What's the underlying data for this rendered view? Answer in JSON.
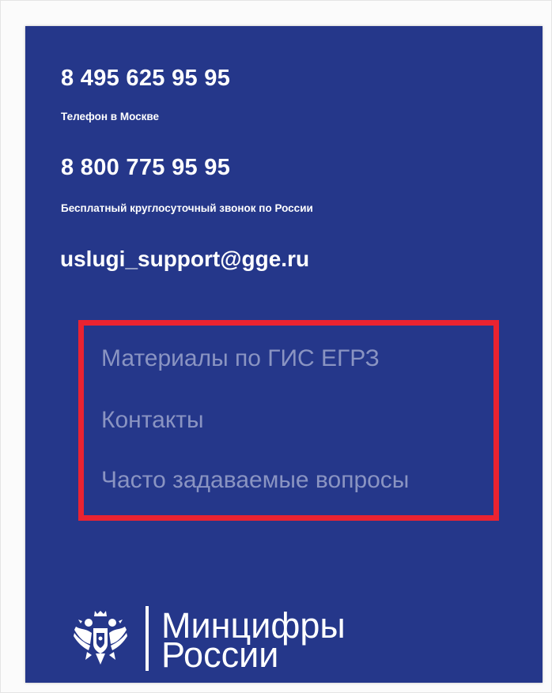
{
  "contacts": {
    "phone_moscow": "8 495 625 95 95",
    "phone_moscow_caption": "Телефон в Москве",
    "phone_free": "8 800 775 95 95",
    "phone_free_caption": "Бесплатный круглосуточный звонок по России",
    "email": "uslugi_support@gge.ru"
  },
  "nav": {
    "items": [
      {
        "label": "Материалы по ГИС ЕГРЗ"
      },
      {
        "label": "Контакты"
      },
      {
        "label": "Часто задаваемые вопросы"
      }
    ]
  },
  "logo": {
    "line1": "Минцифры",
    "line2": "России",
    "emblem_icon": "double-headed-eagle-icon"
  },
  "colors": {
    "panel_background": "#25378a",
    "link_color": "#8a94c2",
    "highlight_border": "#ea2331",
    "text": "#ffffff"
  }
}
